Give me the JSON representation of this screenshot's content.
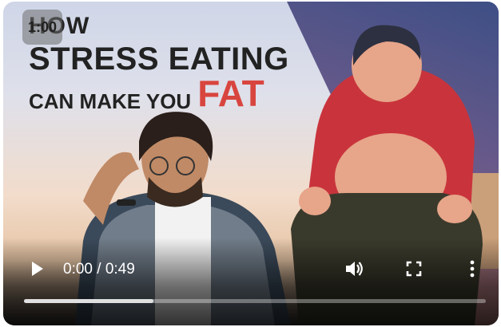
{
  "thumbnail": {
    "title_line1": "HOW",
    "title_line2": "STRESS EATING",
    "title_line3": "CAN MAKE YOU",
    "title_accent": "FAT",
    "badge": "1:00"
  },
  "player": {
    "current_time": "0:00",
    "separator": " / ",
    "duration": "0:49",
    "progress_fraction": 0.28,
    "icons": {
      "play": "play-icon",
      "volume": "volume-icon",
      "fullscreen": "fullscreen-icon",
      "more": "more-vertical-icon"
    }
  },
  "colors": {
    "accent": "#d8453e",
    "control_fg": "#ffffff"
  }
}
